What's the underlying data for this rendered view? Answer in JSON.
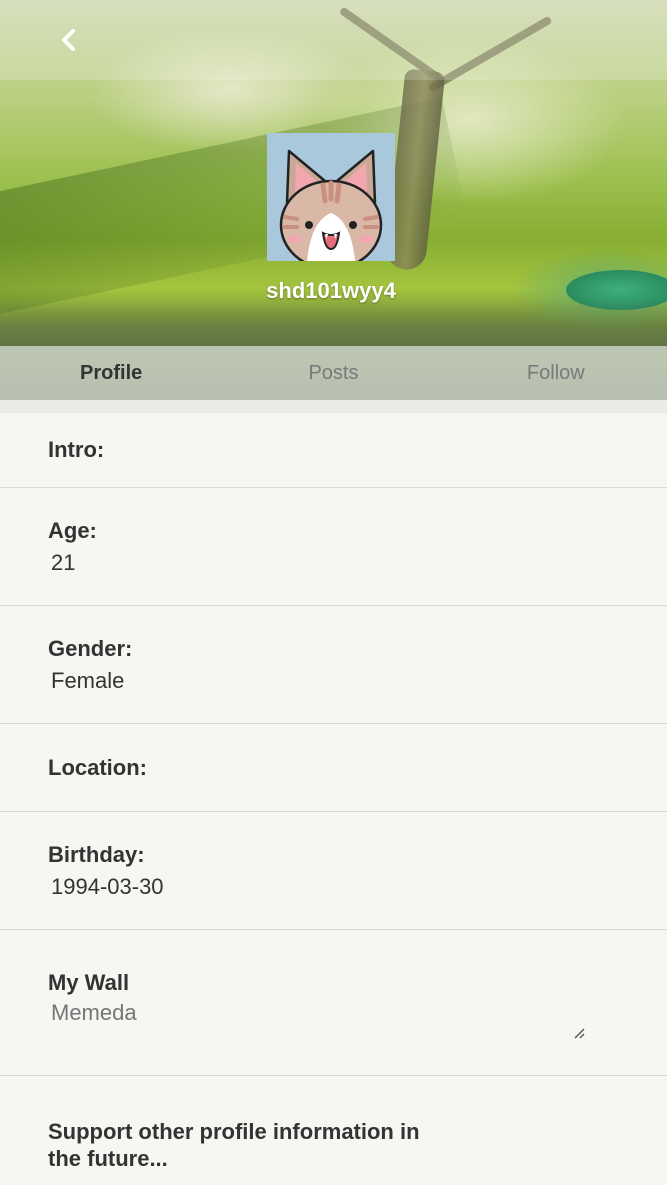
{
  "header": {
    "username": "shd101wyy4",
    "back_icon": "chevron-left-icon"
  },
  "tabs": [
    {
      "label": "Profile",
      "active": true
    },
    {
      "label": "Posts",
      "active": false
    },
    {
      "label": "Follow",
      "active": false
    }
  ],
  "profile": {
    "intro": {
      "label": "Intro:",
      "value": ""
    },
    "age": {
      "label": "Age:",
      "value": "21"
    },
    "gender": {
      "label": "Gender:",
      "value": "Female"
    },
    "location": {
      "label": "Location:",
      "value": ""
    },
    "birthday": {
      "label": "Birthday:",
      "value": "1994-03-30"
    },
    "wall": {
      "label": "My Wall",
      "placeholder": "Memeda"
    }
  },
  "footer_note": "Support other profile information in the future...",
  "colors": {
    "text": "#333333",
    "tab_inactive": "#7a7a7a",
    "placeholder": "#aaaaaa",
    "page_bg": "#f7f6f3"
  }
}
